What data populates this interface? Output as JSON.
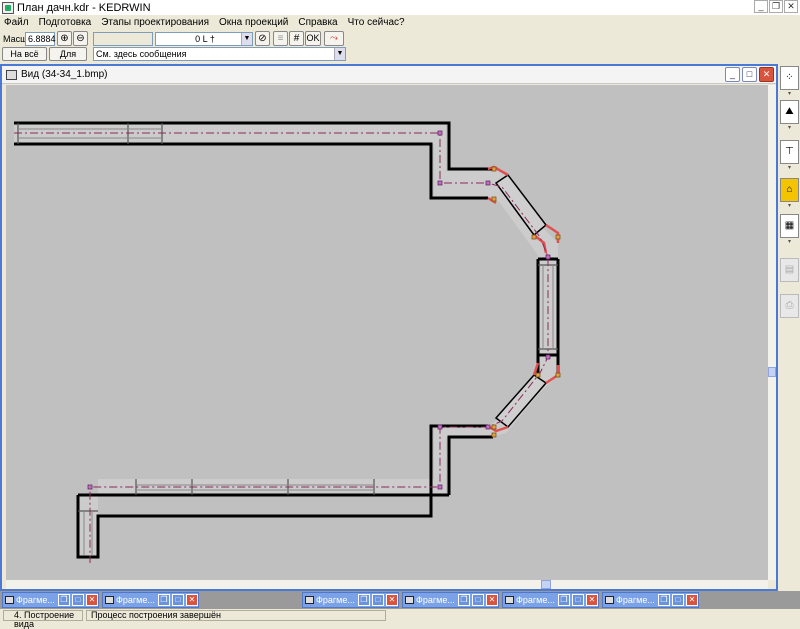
{
  "app": {
    "title": "План дачн.kdr - KEDRWIN"
  },
  "menu": [
    "Файл",
    "Подготовка",
    "Этапы проектирования",
    "Окна проекций",
    "Справка",
    "Что сейчас?"
  ],
  "toolbar": {
    "scale_label": "Масшт",
    "scale_value": "6.8884",
    "fit_window_label": "На всё окно",
    "for_all_label": "Для всех",
    "layer_value": "0 L †",
    "ok_label": "OK",
    "message_placeholder": "См. здесь сообщения"
  },
  "child_window": {
    "title": "Вид (34-34_1.bmp)"
  },
  "fragments": [
    "Фрагме...",
    "Фрагме...",
    "Фрагме...",
    "Фрагме...",
    "Фрагме...",
    "Фрагме..."
  ],
  "status": {
    "left": "4. Построение вида",
    "right": "Процесс построения завершён"
  },
  "icons": {
    "zoom_in": "zoom-in-icon",
    "zoom_out": "zoom-out-icon",
    "grid": "grid-icon",
    "ok": "ok-icon",
    "route": "route-icon",
    "target": "target-icon"
  },
  "colors": {
    "canvas": "#c0c0c0",
    "wall": "#000000",
    "highlight": "#e05050",
    "accent": "#4a7ad6"
  }
}
